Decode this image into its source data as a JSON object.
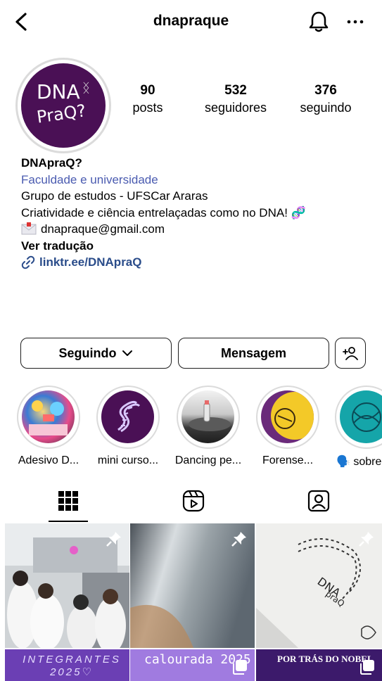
{
  "header": {
    "username": "dnapraque",
    "back_icon": "chevron-left-icon",
    "bell_icon": "bell-icon",
    "more_icon": "more-horizontal-icon"
  },
  "profile": {
    "avatar": {
      "line1": "DNA",
      "line2": "PraQ?",
      "bg_color": "#4a1055"
    },
    "stats": {
      "posts": {
        "value": "90",
        "label": "posts"
      },
      "followers": {
        "value": "532",
        "label": "seguidores"
      },
      "following": {
        "value": "376",
        "label": "seguindo"
      }
    }
  },
  "bio": {
    "name": "DNApraQ?",
    "category": "Faculdade e universidade",
    "line1": "Grupo de estudos - UFSCar Araras",
    "line2": "Criatividade e ciência entrelaçadas como no DNA! 🧬",
    "email": "dnapraque@gmail.com",
    "see_translation": "Ver tradução",
    "link": "linktr.ee/DNApraQ"
  },
  "actions": {
    "following_label": "Seguindo",
    "message_label": "Mensagem"
  },
  "highlights": [
    {
      "label": "Adesivo D..."
    },
    {
      "label": "mini curso..."
    },
    {
      "label": "Dancing pe..."
    },
    {
      "label": "Forense..."
    },
    {
      "label": "🗣️ sobre"
    }
  ],
  "tabs": [
    "grid-icon",
    "reels-icon",
    "tagged-icon"
  ],
  "grid": {
    "posts": [
      {
        "kind": "photo-lab",
        "pinned": true
      },
      {
        "kind": "photo-blur",
        "pinned": true
      },
      {
        "kind": "photo-paper",
        "pinned": true,
        "text": "DNA praQ"
      },
      {
        "kind": "text-post",
        "text": "INTEGRANTES 2025♡"
      },
      {
        "kind": "text-post",
        "text": "calourada 2025"
      },
      {
        "kind": "text-post",
        "text": "POR TRÁS DO NOBEL"
      }
    ]
  }
}
